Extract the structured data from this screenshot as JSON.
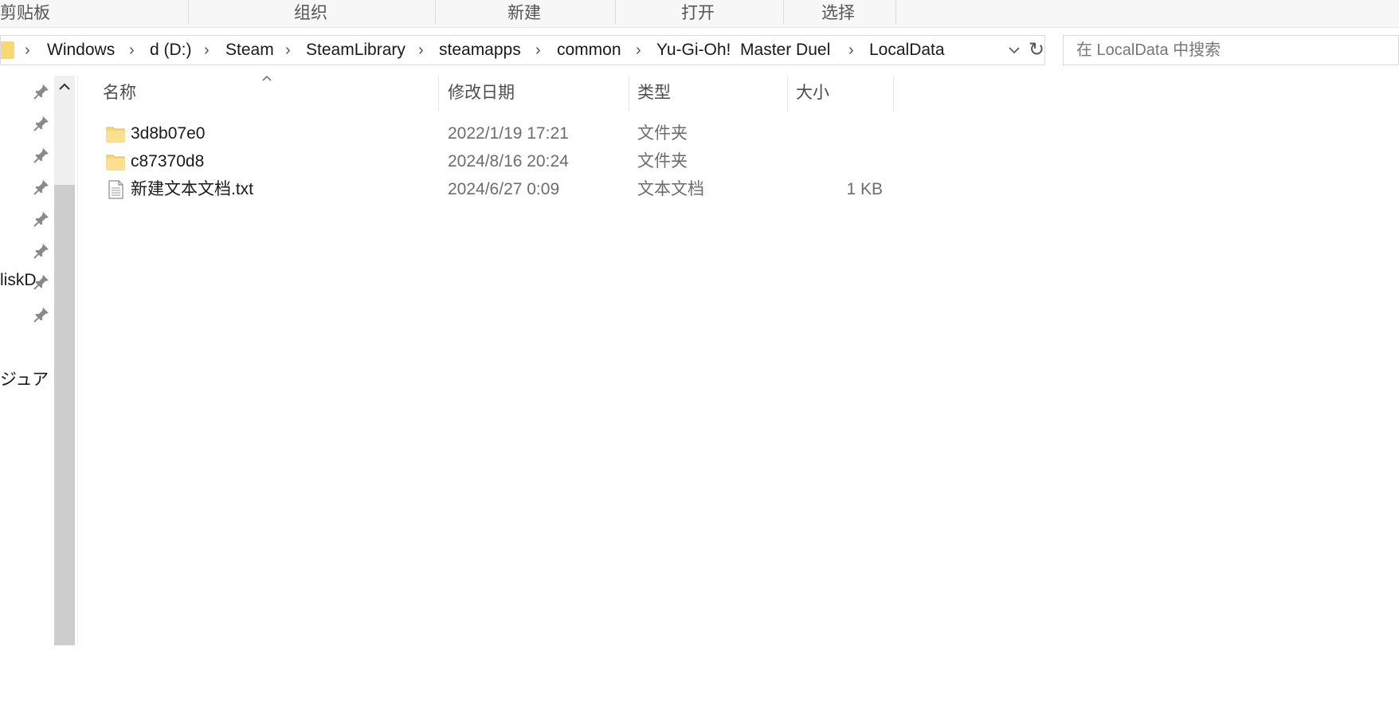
{
  "ribbon": {
    "groups": [
      "剪贴板",
      "组织",
      "新建",
      "打开",
      "选择"
    ]
  },
  "address": {
    "crumbs": [
      "Windows",
      "d (D:)",
      "Steam",
      "SteamLibrary",
      "steamapps",
      "common",
      "Yu-Gi-Oh!  Master Duel",
      "LocalData"
    ],
    "search_placeholder": "在 LocalData 中搜索"
  },
  "nav": {
    "partial_items": [
      "liskD",
      "ジュア"
    ]
  },
  "columns": {
    "name": "名称",
    "date": "修改日期",
    "type": "类型",
    "size": "大小"
  },
  "files": [
    {
      "name": "3d8b07e0",
      "date": "2022/1/19 17:21",
      "type": "文件夹",
      "size": "",
      "icon": "folder-icon"
    },
    {
      "name": "c87370d8",
      "date": "2024/8/16 20:24",
      "type": "文件夹",
      "size": "",
      "icon": "folder-icon"
    },
    {
      "name": "新建文本文档.txt",
      "date": "2024/6/27 0:09",
      "type": "文本文档",
      "size": "1 KB",
      "icon": "text-file-icon"
    }
  ],
  "colors": {
    "folder": "#f8d775",
    "header_text": "#4d4d4d",
    "meta_text": "#6d6d6d"
  }
}
